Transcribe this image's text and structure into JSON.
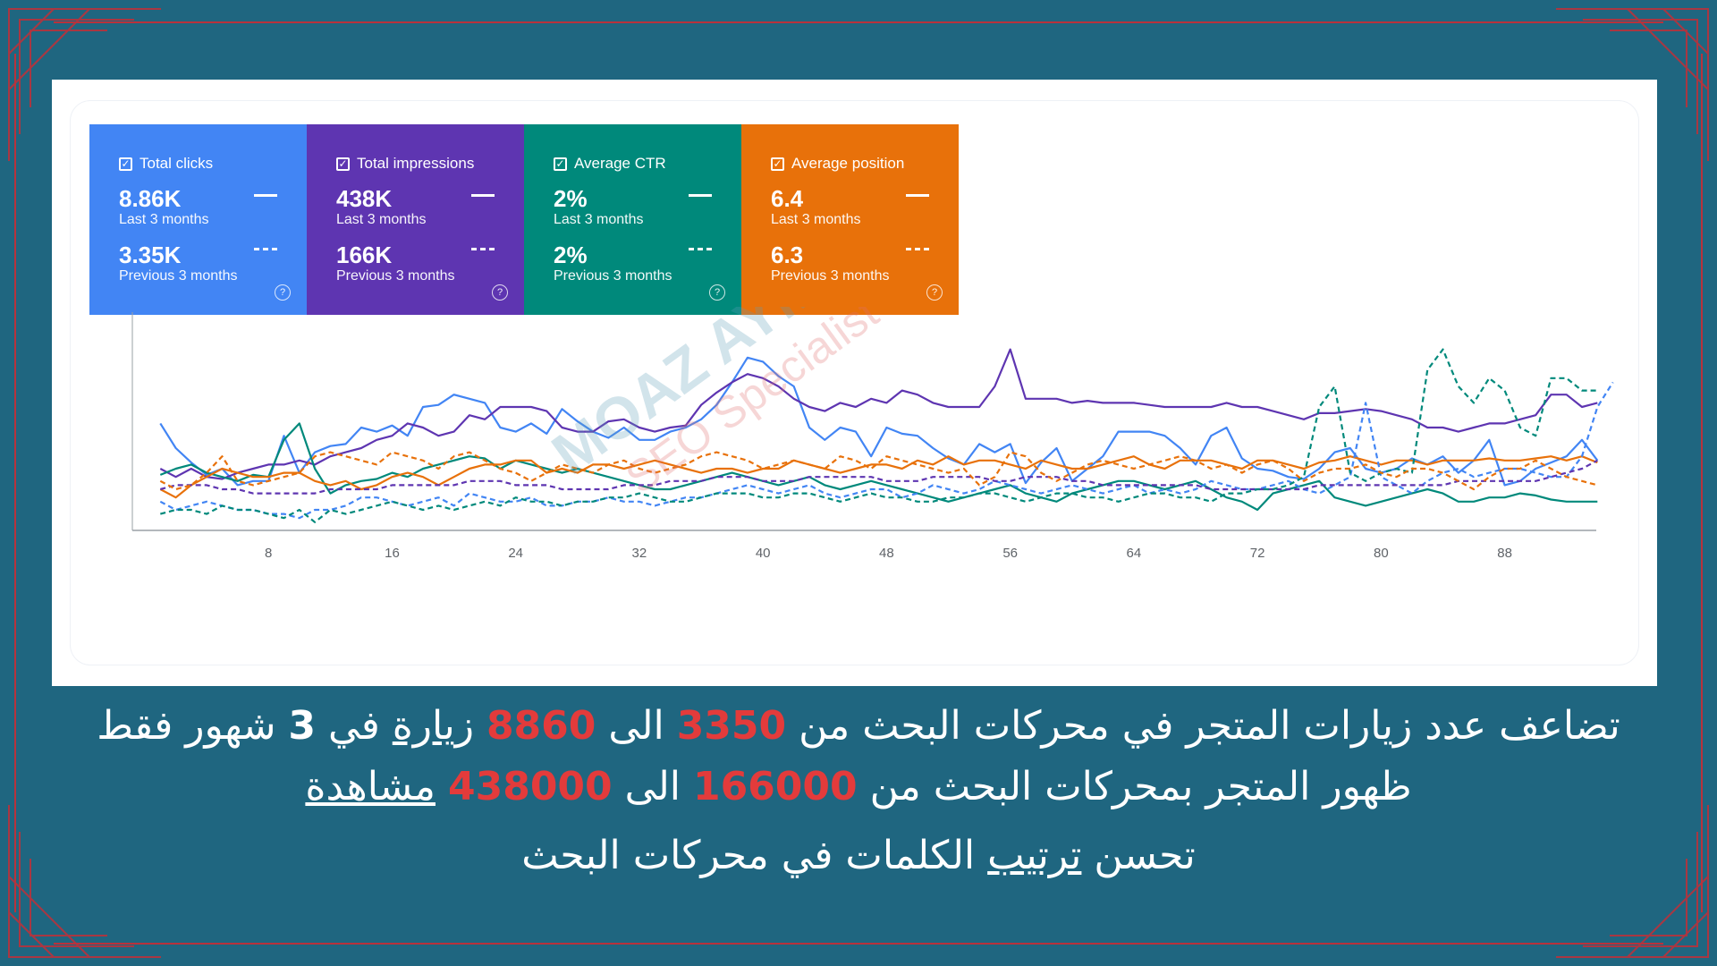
{
  "colors": {
    "background": "#1f6680",
    "frame": "#b8323c",
    "clicks": "#4285f4",
    "impressions": "#5e35b1",
    "ctr": "#00897b",
    "position": "#e8710a",
    "highlight": "#e33b3b"
  },
  "cards": [
    {
      "title": "Total clicks",
      "value_current": "8.86K",
      "label_current": "Last 3 months",
      "value_previous": "3.35K",
      "label_previous": "Previous 3 months",
      "color": "#4285f4"
    },
    {
      "title": "Total impressions",
      "value_current": "438K",
      "label_current": "Last 3 months",
      "value_previous": "166K",
      "label_previous": "Previous 3 months",
      "color": "#5e35b1"
    },
    {
      "title": "Average CTR",
      "value_current": "2%",
      "label_current": "Last 3 months",
      "value_previous": "2%",
      "label_previous": "Previous 3 months",
      "color": "#00897b"
    },
    {
      "title": "Average position",
      "value_current": "6.4",
      "label_current": "Last 3 months",
      "value_previous": "6.3",
      "label_previous": "Previous 3 months",
      "color": "#e8710a"
    }
  ],
  "watermark": {
    "name": "MOAZ AYMAN",
    "role": "SEO Specialist"
  },
  "chart_data": {
    "type": "line",
    "x_ticks": [
      8,
      16,
      24,
      32,
      40,
      48,
      56,
      64,
      72,
      80,
      88
    ],
    "xlim": [
      0,
      93
    ],
    "ylim": [
      0,
      100
    ],
    "grid": false,
    "series": [
      {
        "style": "solid",
        "color": "#4285f4",
        "values": [
          52,
          40,
          33,
          27,
          30,
          22,
          24,
          24,
          46,
          28,
          38,
          41,
          42,
          50,
          48,
          51,
          46,
          60,
          61,
          66,
          64,
          62,
          50,
          48,
          52,
          47,
          59,
          53,
          48,
          45,
          50,
          44,
          44,
          48,
          50,
          54,
          61,
          72,
          84,
          82,
          75,
          70,
          50,
          44,
          50,
          48,
          36,
          50,
          47,
          46,
          40,
          35,
          32,
          42,
          38,
          42,
          23,
          33,
          40,
          24,
          30,
          36,
          48,
          48,
          48,
          46,
          40,
          32,
          46,
          50,
          35,
          30,
          29,
          26,
          25,
          30,
          38,
          40,
          30,
          28,
          30,
          35,
          32,
          36,
          28,
          34,
          44,
          22,
          24,
          30,
          33,
          36,
          44,
          34
        ]
      },
      {
        "style": "solid",
        "color": "#5e35b1",
        "values": [
          30,
          26,
          30,
          26,
          25,
          28,
          30,
          32,
          32,
          34,
          32,
          36,
          38,
          40,
          44,
          46,
          52,
          50,
          46,
          48,
          56,
          54,
          60,
          60,
          60,
          58,
          50,
          48,
          48,
          53,
          54,
          50,
          48,
          50,
          51,
          61,
          67,
          72,
          76,
          74,
          70,
          64,
          60,
          58,
          62,
          60,
          64,
          62,
          68,
          66,
          62,
          60,
          60,
          60,
          70,
          88,
          64,
          64,
          64,
          62,
          63,
          62,
          62,
          62,
          61,
          60,
          60,
          60,
          60,
          62,
          60,
          60,
          58,
          56,
          54,
          57,
          57,
          58,
          59,
          58,
          56,
          54,
          50,
          50,
          48,
          50,
          52,
          52,
          54,
          56,
          66,
          66,
          60,
          62
        ]
      },
      {
        "style": "solid",
        "color": "#00897b",
        "values": [
          27,
          30,
          32,
          28,
          26,
          24,
          27,
          26,
          44,
          52,
          30,
          18,
          22,
          24,
          25,
          28,
          26,
          30,
          32,
          34,
          36,
          35,
          30,
          34,
          32,
          30,
          28,
          30,
          28,
          26,
          24,
          22,
          20,
          20,
          22,
          24,
          26,
          28,
          26,
          24,
          22,
          24,
          26,
          22,
          20,
          22,
          24,
          22,
          20,
          18,
          16,
          14,
          16,
          18,
          20,
          22,
          18,
          16,
          14,
          18,
          20,
          22,
          24,
          24,
          22,
          20,
          22,
          24,
          20,
          16,
          14,
          10,
          18,
          20,
          22,
          24,
          16,
          14,
          12,
          14,
          16,
          18,
          20,
          18,
          14,
          14,
          16,
          16,
          18,
          17,
          15,
          14,
          14,
          14
        ]
      },
      {
        "style": "solid",
        "color": "#e8710a",
        "values": [
          20,
          16,
          22,
          26,
          30,
          28,
          26,
          26,
          28,
          28,
          24,
          22,
          24,
          20,
          22,
          26,
          28,
          26,
          22,
          26,
          30,
          32,
          32,
          34,
          34,
          28,
          30,
          28,
          32,
          32,
          30,
          32,
          34,
          32,
          30,
          28,
          30,
          30,
          28,
          30,
          30,
          34,
          32,
          30,
          28,
          30,
          32,
          32,
          30,
          34,
          32,
          36,
          32,
          34,
          34,
          32,
          30,
          34,
          32,
          30,
          30,
          32,
          34,
          36,
          32,
          30,
          34,
          34,
          34,
          32,
          30,
          34,
          34,
          32,
          30,
          33,
          34,
          36,
          34,
          32,
          34,
          34,
          32,
          34,
          34,
          34,
          35,
          34,
          34,
          35,
          36,
          34,
          36,
          33
        ]
      },
      {
        "style": "dashed",
        "color": "#4285f4",
        "values": [
          14,
          10,
          12,
          14,
          12,
          10,
          10,
          8,
          8,
          6,
          10,
          10,
          12,
          16,
          16,
          14,
          12,
          14,
          16,
          12,
          18,
          16,
          14,
          14,
          16,
          12,
          12,
          14,
          14,
          16,
          14,
          14,
          12,
          14,
          16,
          16,
          18,
          20,
          22,
          20,
          18,
          20,
          22,
          18,
          16,
          18,
          20,
          20,
          16,
          18,
          22,
          20,
          18,
          20,
          24,
          22,
          20,
          18,
          20,
          22,
          20,
          18,
          20,
          22,
          18,
          20,
          18,
          20,
          24,
          22,
          20,
          20,
          22,
          24,
          20,
          18,
          22,
          26,
          62,
          26,
          22,
          18,
          24,
          28,
          30,
          26,
          28,
          30,
          30,
          28,
          26,
          26,
          36,
          60,
          72
        ]
      },
      {
        "style": "dashed",
        "color": "#5e35b1",
        "values": [
          20,
          22,
          22,
          22,
          20,
          20,
          18,
          18,
          18,
          18,
          18,
          20,
          20,
          20,
          20,
          22,
          22,
          22,
          22,
          22,
          24,
          24,
          24,
          22,
          22,
          22,
          20,
          20,
          20,
          20,
          22,
          22,
          22,
          24,
          24,
          24,
          26,
          26,
          26,
          24,
          24,
          24,
          26,
          26,
          26,
          26,
          26,
          24,
          24,
          24,
          26,
          26,
          26,
          26,
          24,
          24,
          26,
          26,
          26,
          24,
          24,
          22,
          22,
          22,
          22,
          22,
          22,
          22,
          20,
          20,
          20,
          20,
          20,
          20,
          20,
          22,
          22,
          22,
          22,
          22,
          22,
          22,
          22,
          22,
          24,
          24,
          24,
          24,
          24,
          24,
          26,
          28,
          30,
          34
        ]
      },
      {
        "style": "dashed",
        "color": "#00897b",
        "values": [
          8,
          10,
          10,
          8,
          12,
          10,
          10,
          8,
          6,
          10,
          4,
          10,
          8,
          10,
          12,
          14,
          12,
          10,
          12,
          10,
          12,
          14,
          12,
          16,
          14,
          14,
          12,
          14,
          14,
          16,
          16,
          18,
          16,
          14,
          14,
          16,
          18,
          18,
          18,
          16,
          16,
          18,
          18,
          16,
          14,
          16,
          18,
          16,
          16,
          14,
          14,
          16,
          16,
          18,
          18,
          16,
          14,
          16,
          18,
          18,
          16,
          16,
          14,
          16,
          18,
          18,
          16,
          16,
          14,
          18,
          18,
          20,
          20,
          22,
          26,
          60,
          70,
          28,
          24,
          28,
          30,
          28,
          78,
          88,
          70,
          62,
          74,
          68,
          50,
          46,
          74,
          74,
          68,
          68
        ]
      },
      {
        "style": "dashed",
        "color": "#e8710a",
        "values": [
          24,
          20,
          22,
          28,
          36,
          24,
          22,
          24,
          26,
          28,
          36,
          38,
          36,
          34,
          32,
          38,
          36,
          34,
          30,
          36,
          38,
          34,
          30,
          28,
          24,
          28,
          32,
          30,
          28,
          32,
          34,
          30,
          28,
          30,
          32,
          36,
          38,
          36,
          34,
          30,
          32,
          34,
          32,
          30,
          36,
          34,
          30,
          36,
          34,
          32,
          30,
          28,
          30,
          22,
          26,
          38,
          36,
          28,
          24,
          28,
          32,
          34,
          32,
          30,
          32,
          34,
          36,
          34,
          30,
          32,
          28,
          32,
          34,
          30,
          24,
          28,
          30,
          30,
          32,
          28,
          26,
          30,
          30,
          28,
          24,
          20,
          26,
          30,
          30,
          34,
          30,
          26,
          24,
          22
        ]
      }
    ]
  },
  "captions": {
    "line1": {
      "a": "تضاعف عدد زيارات المتجر في محركات البحث من ",
      "n1": "3350",
      "b": " الى ",
      "n2": "8860",
      "c": " ",
      "u": "زيارة",
      "d": " في ",
      "n3": "3",
      "e": " شهور فقط"
    },
    "line2": {
      "a": "ظهور المتجر بمحركات البحث من ",
      "n1": "166000",
      "b": " الى ",
      "n2": "438000",
      "c": " ",
      "u": "مشاهدة"
    },
    "line3": {
      "a": "تحسن ",
      "u": "ترتيب",
      "b": " الكلمات في محركات البحث"
    }
  }
}
